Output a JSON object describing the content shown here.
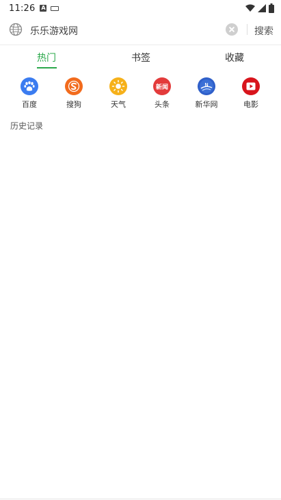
{
  "status_bar": {
    "time": "11:26",
    "notification_icons": [
      "text-a-icon",
      "keyboard-icon"
    ],
    "system_icons": [
      "wifi-icon",
      "signal-icon",
      "battery-icon"
    ]
  },
  "search_bar": {
    "query": "乐乐游戏网",
    "search_button_label": "搜索",
    "globe_icon": "globe-icon",
    "clear_icon": "clear-icon"
  },
  "tabs": [
    {
      "label": "热门",
      "active": true
    },
    {
      "label": "书签",
      "active": false
    },
    {
      "label": "收藏",
      "active": false
    }
  ],
  "shortcuts": [
    {
      "label": "百度",
      "icon": "baidu-paw-icon",
      "color": "#3b7cf0"
    },
    {
      "label": "搜狗",
      "icon": "sogou-icon",
      "color": "#f26b1d"
    },
    {
      "label": "天气",
      "icon": "sun-icon",
      "color": "#f6b11a"
    },
    {
      "label": "头条",
      "icon": "news-icon",
      "icon_text": "新闻",
      "color": "#e33b3b"
    },
    {
      "label": "新华网",
      "icon": "xinhua-icon",
      "color": "#2f5fc9"
    },
    {
      "label": "电影",
      "icon": "play-icon",
      "color": "#d8141c"
    }
  ],
  "history": {
    "title": "历史记录"
  },
  "theme": {
    "accent": "#2aa84a"
  }
}
